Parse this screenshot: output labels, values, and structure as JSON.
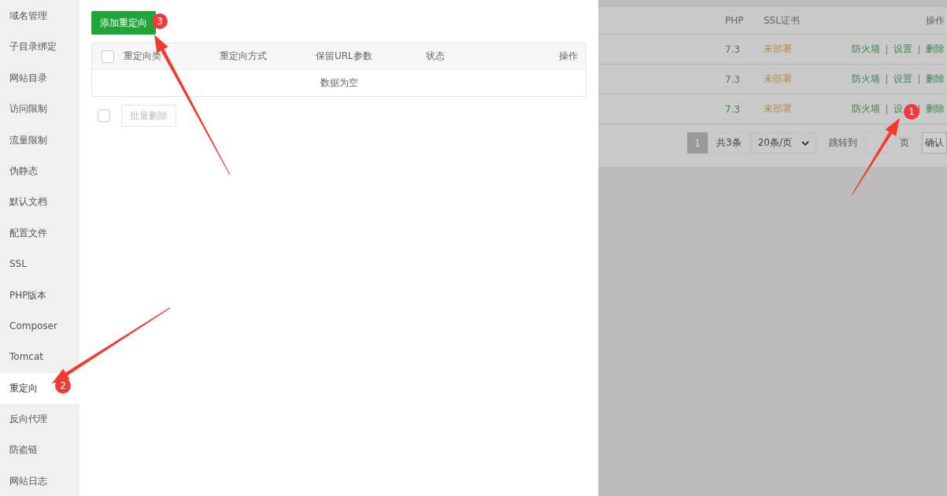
{
  "sidebar": {
    "items": [
      {
        "label": "域名管理",
        "selected": false
      },
      {
        "label": "子目录绑定",
        "selected": false
      },
      {
        "label": "网站目录",
        "selected": false
      },
      {
        "label": "访问限制",
        "selected": false
      },
      {
        "label": "流量限制",
        "selected": false
      },
      {
        "label": "伪静态",
        "selected": false
      },
      {
        "label": "默认文档",
        "selected": false
      },
      {
        "label": "配置文件",
        "selected": false
      },
      {
        "label": "SSL",
        "selected": false
      },
      {
        "label": "PHP版本",
        "selected": false
      },
      {
        "label": "Composer",
        "selected": false
      },
      {
        "label": "Tomcat",
        "selected": false
      },
      {
        "label": "重定向",
        "selected": true
      },
      {
        "label": "反向代理",
        "selected": false
      },
      {
        "label": "防盗链",
        "selected": false
      },
      {
        "label": "网站日志",
        "selected": false
      }
    ]
  },
  "panel": {
    "add_button": "添加重定向",
    "table": {
      "select_all_checked": false,
      "columns": [
        "重定向类",
        "重定向方式",
        "保留URL参数",
        "状态",
        "操作"
      ],
      "empty_text": "数据为空"
    },
    "footer": {
      "checked": false,
      "batch_delete": "批量删除"
    }
  },
  "background": {
    "columns": [
      "PHP",
      "SSL证书",
      "操作"
    ],
    "rows": [
      {
        "php": "7.3",
        "ssl": "未部署",
        "actions": [
          "防火墙",
          "设置",
          "删除"
        ]
      },
      {
        "php": "7.3",
        "ssl": "未部署",
        "actions": [
          "防火墙",
          "设置",
          "删除"
        ]
      },
      {
        "php": "7.3",
        "ssl": "未部署",
        "actions": [
          "防火墙",
          "设",
          "删除"
        ]
      }
    ],
    "pagination": {
      "current": "1",
      "total": "共3条",
      "page_size": "20条/页",
      "jump_label": "跳转到",
      "page_unit": "页",
      "confirm": "确认"
    }
  },
  "annotations": [
    {
      "number": "1"
    },
    {
      "number": "2"
    },
    {
      "number": "3"
    }
  ]
}
